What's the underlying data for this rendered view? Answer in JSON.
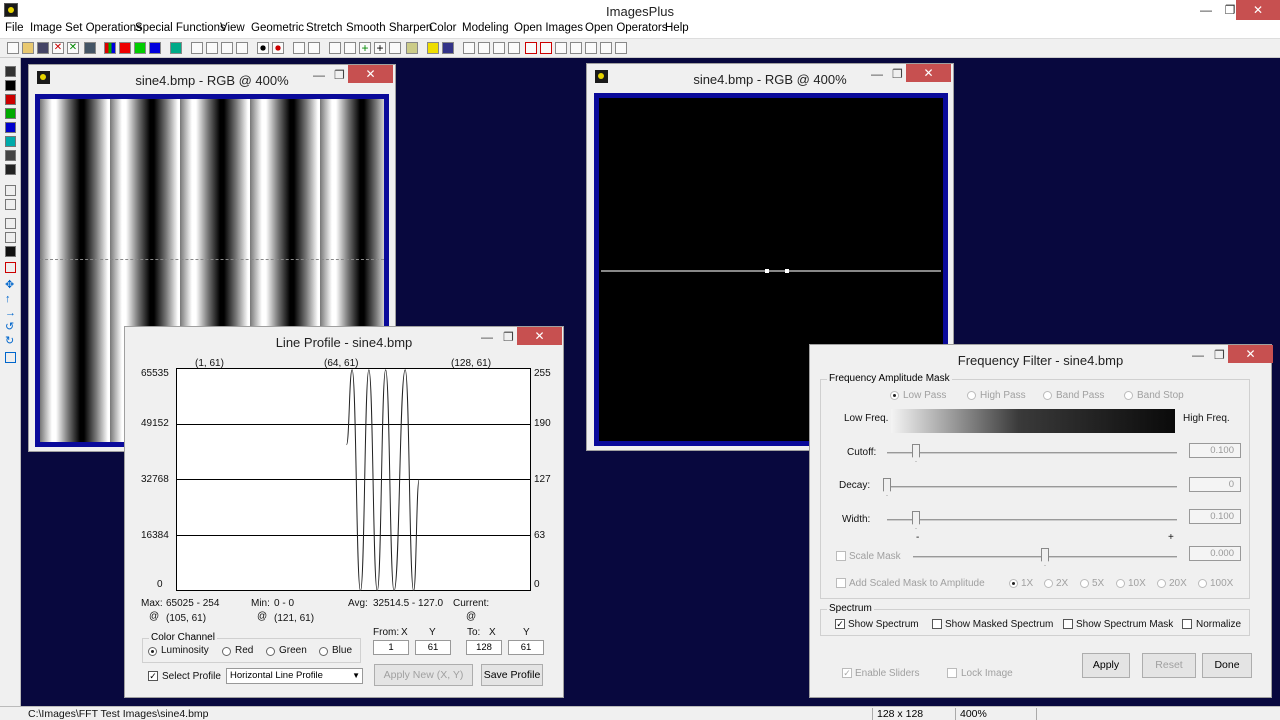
{
  "app": {
    "title": "ImagesPlus",
    "minimize": "—",
    "maximize": "❐",
    "close": "✕"
  },
  "menu": [
    "File",
    "Image Set Operations",
    "Special Functions",
    "View",
    "Geometric",
    "Stretch",
    "Smooth Sharpen",
    "Color",
    "Modeling",
    "Open Images",
    "Open Operators",
    "Help"
  ],
  "image_window_1": {
    "title": "sine4.bmp - RGB @ 400%"
  },
  "image_window_2": {
    "title": "sine4.bmp - RGB @ 400%"
  },
  "line_profile": {
    "title": "Line Profile - sine4.bmp",
    "top_labels": [
      "(1, 61)",
      "(64, 61)",
      "(128, 61)"
    ],
    "left_axis": [
      "65535",
      "49152",
      "32768",
      "16384",
      "0"
    ],
    "right_axis": [
      "255",
      "190",
      "127",
      "63",
      "0"
    ],
    "max_label": "Max:",
    "max_value": "65025 - 254",
    "max_at": "@",
    "max_pos": "(105, 61)",
    "min_label": "Min:",
    "min_value": "0 - 0",
    "min_at": "@",
    "min_pos": "(121, 61)",
    "avg_label": "Avg:",
    "avg_value": "32514.5 - 127.0",
    "current_label": "Current:",
    "current_at": "@",
    "color_channel_title": "Color Channel",
    "channels": [
      "Luminosity",
      "Red",
      "Green",
      "Blue"
    ],
    "selected_channel": "Luminosity",
    "from_label": "From:",
    "to_label": "To:",
    "x_label": "X",
    "y_label": "Y",
    "from_x": "1",
    "from_y": "61",
    "to_x": "128",
    "to_y": "61",
    "select_profile_label": "Select Profile",
    "select_profile_checked": true,
    "profile_type": "Horizontal Line Profile",
    "apply_new_button": "Apply New (X, Y)",
    "save_profile_button": "Save Profile"
  },
  "frequency_filter": {
    "title": "Frequency Filter - sine4.bmp",
    "mask_group_title": "Frequency Amplitude Mask",
    "pass_options": [
      "Low Pass",
      "High Pass",
      "Band Pass",
      "Band Stop"
    ],
    "low_freq_label": "Low Freq.",
    "high_freq_label": "High Freq.",
    "cutoff_label": "Cutoff:",
    "cutoff_value": "0.100",
    "cutoff_level": 0.1,
    "decay_label": "Decay:",
    "decay_value": "0",
    "decay_level": 0.0,
    "width_label": "Width:",
    "width_value": "0.100",
    "width_level": 0.1,
    "scale_mask_label": "Scale Mask",
    "scale_minus": "-",
    "scale_plus": "+",
    "scale_value": "0.000",
    "scale_level": 0.5,
    "add_scaled_label": "Add Scaled Mask to Amplitude",
    "multipliers": [
      "1X",
      "2X",
      "5X",
      "10X",
      "20X",
      "100X"
    ],
    "spectrum_group_title": "Spectrum",
    "show_spectrum": "Show Spectrum",
    "show_masked": "Show Masked Spectrum",
    "show_mask": "Show Spectrum Mask",
    "normalize": "Normalize",
    "enable_sliders": "Enable Sliders",
    "lock_image": "Lock Image",
    "apply_button": "Apply",
    "reset_button": "Reset",
    "done_button": "Done"
  },
  "status": {
    "path": "C:\\Images\\FFT Test Images\\sine4.bmp",
    "size": "128 x 128",
    "zoom": "400%"
  },
  "chart_data": {
    "type": "line",
    "title": "",
    "xlabel": "",
    "ylabel": "",
    "x_range": [
      1,
      128
    ],
    "ylim": [
      0,
      65535
    ],
    "y_ticks": [
      0,
      16384,
      32768,
      49152,
      65535
    ],
    "series": [
      {
        "values": [
          {
            "x": 62,
            "y": 43000
          },
          {
            "x": 64,
            "y": 65025
          },
          {
            "x": 67,
            "y": 0
          },
          {
            "x": 70,
            "y": 65025
          },
          {
            "x": 73,
            "y": 0
          },
          {
            "x": 76,
            "y": 65025
          },
          {
            "x": 79,
            "y": 0
          },
          {
            "x": 83,
            "y": 65025
          },
          {
            "x": 86,
            "y": 0
          },
          {
            "x": 88,
            "y": 32768
          }
        ]
      }
    ]
  }
}
